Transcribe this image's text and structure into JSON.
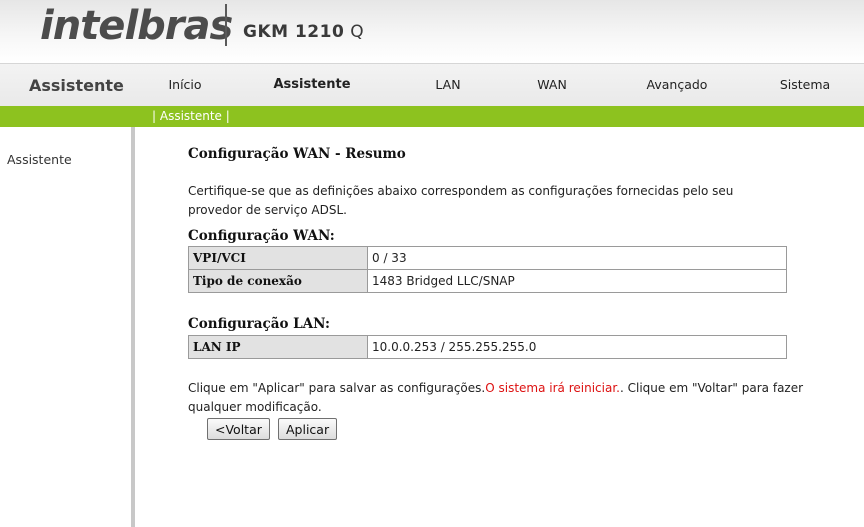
{
  "header": {
    "logo_text": "intelbras",
    "model_bold": "GKM 1210",
    "model_suffix": "Q"
  },
  "nav": {
    "section_title": "Assistente",
    "items": [
      {
        "label": "Início",
        "active": false
      },
      {
        "label": "Assistente",
        "active": true
      },
      {
        "label": "LAN",
        "active": false
      },
      {
        "label": "WAN",
        "active": false
      },
      {
        "label": "Avançado",
        "active": false
      },
      {
        "label": "Sistema",
        "active": false
      }
    ]
  },
  "subnav": {
    "text": "| Assistente |"
  },
  "sidebar": {
    "items": [
      {
        "label": "Assistente"
      }
    ]
  },
  "main": {
    "title": "Configuração WAN - Resumo",
    "intro": "Certifique-se que as definições abaixo correspondem as configurações fornecidas pelo seu provedor de serviço ADSL.",
    "wan": {
      "heading": "Configuração WAN:",
      "rows": [
        {
          "label": "VPI/VCI",
          "value": "0 / 33"
        },
        {
          "label": "Tipo de conexão",
          "value": "1483 Bridged LLC/SNAP"
        }
      ]
    },
    "lan": {
      "heading": "Configuração LAN:",
      "rows": [
        {
          "label": "LAN IP",
          "value": "10.0.0.253 / 255.255.255.0"
        }
      ]
    },
    "note": {
      "before": "Clique em \"Aplicar\" para salvar as configurações.",
      "warning": "O sistema irá reiniciar.",
      "after": ". Clique em \"Voltar\" para fazer qualquer modificação."
    },
    "buttons": {
      "back": "<Voltar",
      "apply": "Aplicar"
    }
  },
  "colors": {
    "accent_green": "#8dc21f",
    "warning_red": "#dd1111"
  }
}
